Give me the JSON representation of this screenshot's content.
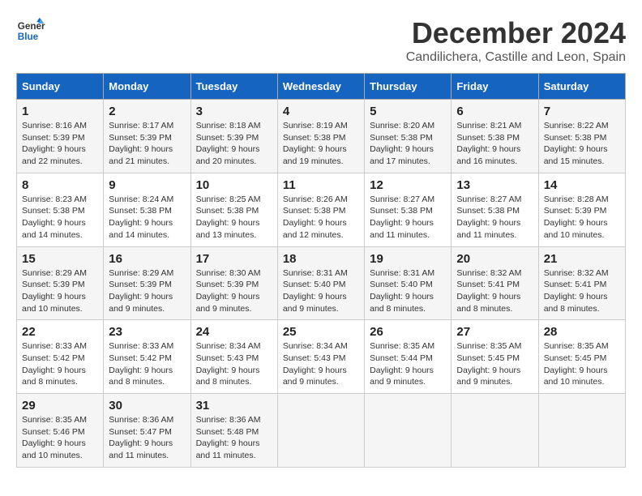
{
  "logo": {
    "line1": "General",
    "line2": "Blue"
  },
  "title": "December 2024",
  "location": "Candilichera, Castille and Leon, Spain",
  "days_header": [
    "Sunday",
    "Monday",
    "Tuesday",
    "Wednesday",
    "Thursday",
    "Friday",
    "Saturday"
  ],
  "weeks": [
    [
      {
        "day": "1",
        "sunrise": "Sunrise: 8:16 AM",
        "sunset": "Sunset: 5:39 PM",
        "daylight": "Daylight: 9 hours and 22 minutes."
      },
      {
        "day": "2",
        "sunrise": "Sunrise: 8:17 AM",
        "sunset": "Sunset: 5:39 PM",
        "daylight": "Daylight: 9 hours and 21 minutes."
      },
      {
        "day": "3",
        "sunrise": "Sunrise: 8:18 AM",
        "sunset": "Sunset: 5:39 PM",
        "daylight": "Daylight: 9 hours and 20 minutes."
      },
      {
        "day": "4",
        "sunrise": "Sunrise: 8:19 AM",
        "sunset": "Sunset: 5:38 PM",
        "daylight": "Daylight: 9 hours and 19 minutes."
      },
      {
        "day": "5",
        "sunrise": "Sunrise: 8:20 AM",
        "sunset": "Sunset: 5:38 PM",
        "daylight": "Daylight: 9 hours and 17 minutes."
      },
      {
        "day": "6",
        "sunrise": "Sunrise: 8:21 AM",
        "sunset": "Sunset: 5:38 PM",
        "daylight": "Daylight: 9 hours and 16 minutes."
      },
      {
        "day": "7",
        "sunrise": "Sunrise: 8:22 AM",
        "sunset": "Sunset: 5:38 PM",
        "daylight": "Daylight: 9 hours and 15 minutes."
      }
    ],
    [
      {
        "day": "8",
        "sunrise": "Sunrise: 8:23 AM",
        "sunset": "Sunset: 5:38 PM",
        "daylight": "Daylight: 9 hours and 14 minutes."
      },
      {
        "day": "9",
        "sunrise": "Sunrise: 8:24 AM",
        "sunset": "Sunset: 5:38 PM",
        "daylight": "Daylight: 9 hours and 14 minutes."
      },
      {
        "day": "10",
        "sunrise": "Sunrise: 8:25 AM",
        "sunset": "Sunset: 5:38 PM",
        "daylight": "Daylight: 9 hours and 13 minutes."
      },
      {
        "day": "11",
        "sunrise": "Sunrise: 8:26 AM",
        "sunset": "Sunset: 5:38 PM",
        "daylight": "Daylight: 9 hours and 12 minutes."
      },
      {
        "day": "12",
        "sunrise": "Sunrise: 8:27 AM",
        "sunset": "Sunset: 5:38 PM",
        "daylight": "Daylight: 9 hours and 11 minutes."
      },
      {
        "day": "13",
        "sunrise": "Sunrise: 8:27 AM",
        "sunset": "Sunset: 5:38 PM",
        "daylight": "Daylight: 9 hours and 11 minutes."
      },
      {
        "day": "14",
        "sunrise": "Sunrise: 8:28 AM",
        "sunset": "Sunset: 5:39 PM",
        "daylight": "Daylight: 9 hours and 10 minutes."
      }
    ],
    [
      {
        "day": "15",
        "sunrise": "Sunrise: 8:29 AM",
        "sunset": "Sunset: 5:39 PM",
        "daylight": "Daylight: 9 hours and 10 minutes."
      },
      {
        "day": "16",
        "sunrise": "Sunrise: 8:29 AM",
        "sunset": "Sunset: 5:39 PM",
        "daylight": "Daylight: 9 hours and 9 minutes."
      },
      {
        "day": "17",
        "sunrise": "Sunrise: 8:30 AM",
        "sunset": "Sunset: 5:39 PM",
        "daylight": "Daylight: 9 hours and 9 minutes."
      },
      {
        "day": "18",
        "sunrise": "Sunrise: 8:31 AM",
        "sunset": "Sunset: 5:40 PM",
        "daylight": "Daylight: 9 hours and 9 minutes."
      },
      {
        "day": "19",
        "sunrise": "Sunrise: 8:31 AM",
        "sunset": "Sunset: 5:40 PM",
        "daylight": "Daylight: 9 hours and 8 minutes."
      },
      {
        "day": "20",
        "sunrise": "Sunrise: 8:32 AM",
        "sunset": "Sunset: 5:41 PM",
        "daylight": "Daylight: 9 hours and 8 minutes."
      },
      {
        "day": "21",
        "sunrise": "Sunrise: 8:32 AM",
        "sunset": "Sunset: 5:41 PM",
        "daylight": "Daylight: 9 hours and 8 minutes."
      }
    ],
    [
      {
        "day": "22",
        "sunrise": "Sunrise: 8:33 AM",
        "sunset": "Sunset: 5:42 PM",
        "daylight": "Daylight: 9 hours and 8 minutes."
      },
      {
        "day": "23",
        "sunrise": "Sunrise: 8:33 AM",
        "sunset": "Sunset: 5:42 PM",
        "daylight": "Daylight: 9 hours and 8 minutes."
      },
      {
        "day": "24",
        "sunrise": "Sunrise: 8:34 AM",
        "sunset": "Sunset: 5:43 PM",
        "daylight": "Daylight: 9 hours and 8 minutes."
      },
      {
        "day": "25",
        "sunrise": "Sunrise: 8:34 AM",
        "sunset": "Sunset: 5:43 PM",
        "daylight": "Daylight: 9 hours and 9 minutes."
      },
      {
        "day": "26",
        "sunrise": "Sunrise: 8:35 AM",
        "sunset": "Sunset: 5:44 PM",
        "daylight": "Daylight: 9 hours and 9 minutes."
      },
      {
        "day": "27",
        "sunrise": "Sunrise: 8:35 AM",
        "sunset": "Sunset: 5:45 PM",
        "daylight": "Daylight: 9 hours and 9 minutes."
      },
      {
        "day": "28",
        "sunrise": "Sunrise: 8:35 AM",
        "sunset": "Sunset: 5:45 PM",
        "daylight": "Daylight: 9 hours and 10 minutes."
      }
    ],
    [
      {
        "day": "29",
        "sunrise": "Sunrise: 8:35 AM",
        "sunset": "Sunset: 5:46 PM",
        "daylight": "Daylight: 9 hours and 10 minutes."
      },
      {
        "day": "30",
        "sunrise": "Sunrise: 8:36 AM",
        "sunset": "Sunset: 5:47 PM",
        "daylight": "Daylight: 9 hours and 11 minutes."
      },
      {
        "day": "31",
        "sunrise": "Sunrise: 8:36 AM",
        "sunset": "Sunset: 5:48 PM",
        "daylight": "Daylight: 9 hours and 11 minutes."
      },
      null,
      null,
      null,
      null
    ]
  ]
}
